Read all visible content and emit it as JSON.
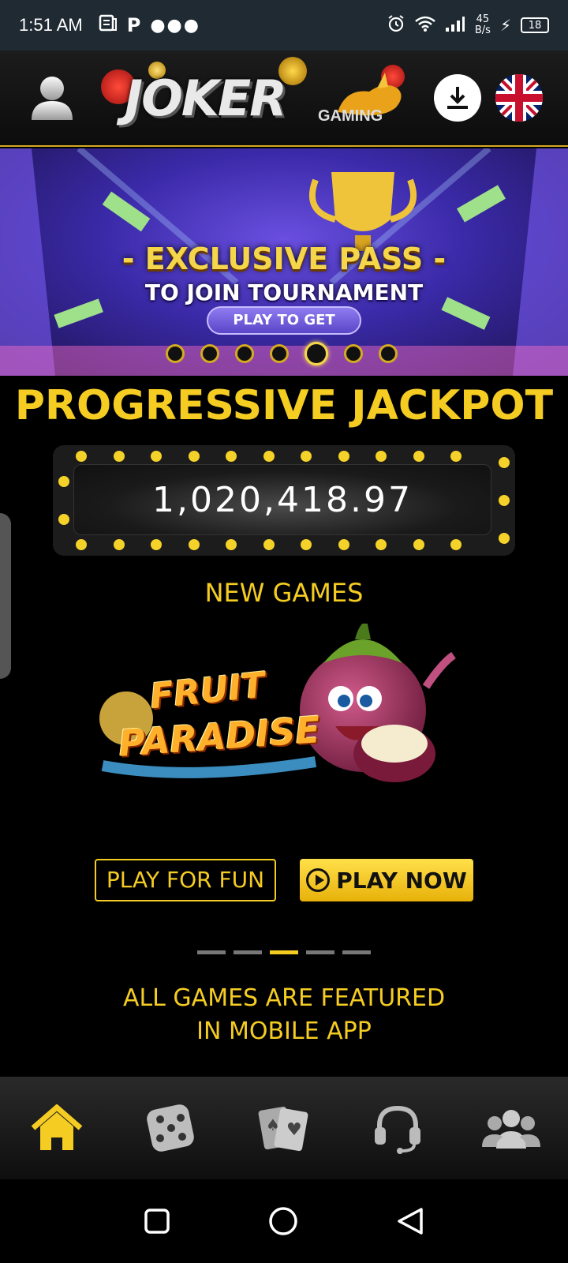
{
  "status_bar": {
    "time": "1:51 AM",
    "speed_top": "45",
    "speed_bottom": "B/s",
    "battery": "18",
    "icons": [
      "news-icon",
      "p-icon",
      "more-dots-icon",
      "alarm-icon",
      "wifi-icon",
      "signal-icon",
      "charging-icon"
    ]
  },
  "header": {
    "logo_text": "JOKER",
    "logo_sub": "GAMING",
    "icons": [
      "avatar-icon",
      "download-icon",
      "uk-flag-icon"
    ]
  },
  "banner": {
    "title": "- EXCLUSIVE PASS -",
    "subtitle": "TO JOIN TOURNAMENT",
    "button": "PLAY TO GET",
    "slide_count": 7,
    "active_slide": 5
  },
  "jackpot": {
    "title": "PROGRESSIVE JACKPOT",
    "value": "1,020,418.97"
  },
  "new_games": {
    "title": "NEW GAMES",
    "game_line1": "FRUIT",
    "game_line2": "PARADISE",
    "play_for_fun": "PLAY FOR FUN",
    "play_now": "PLAY NOW",
    "page_count": 5,
    "active_page": 3
  },
  "featured": {
    "line1": "ALL GAMES ARE FEATURED",
    "line2": "IN MOBILE APP"
  },
  "bottom_nav": {
    "items": [
      "home-icon",
      "dice-icon",
      "cards-icon",
      "support-headset-icon",
      "community-icon"
    ],
    "active_color": "#f5cc22"
  },
  "colors": {
    "accent": "#f5cc22",
    "background": "#000000"
  }
}
